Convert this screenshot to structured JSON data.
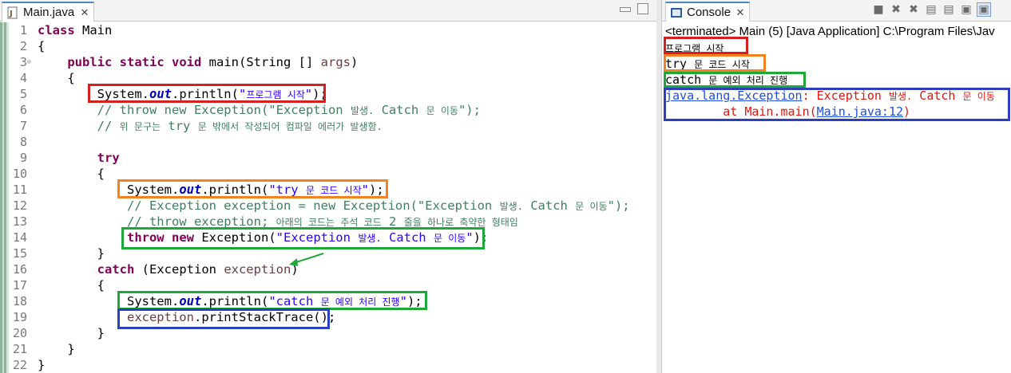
{
  "editor": {
    "tab_label": "Main.java",
    "tab_close": "✕",
    "lines": [
      {
        "num": "1",
        "parts": [
          {
            "c": "kw",
            "t": "class"
          },
          {
            "c": "",
            "t": " Main"
          }
        ]
      },
      {
        "num": "2",
        "parts": [
          {
            "c": "",
            "t": "{"
          }
        ]
      },
      {
        "num": "3",
        "fold": "⊖",
        "parts": [
          {
            "c": "",
            "t": "    "
          },
          {
            "c": "kw",
            "t": "public"
          },
          {
            "c": "",
            "t": " "
          },
          {
            "c": "kw",
            "t": "static"
          },
          {
            "c": "",
            "t": " "
          },
          {
            "c": "kw",
            "t": "void"
          },
          {
            "c": "",
            "t": " main(String [] "
          },
          {
            "c": "var",
            "t": "args"
          },
          {
            "c": "",
            "t": ")"
          }
        ]
      },
      {
        "num": "4",
        "parts": [
          {
            "c": "",
            "t": "    {"
          }
        ]
      },
      {
        "num": "5",
        "parts": [
          {
            "c": "",
            "t": "        System."
          },
          {
            "c": "sf",
            "t": "out"
          },
          {
            "c": "",
            "t": ".println("
          },
          {
            "c": "str",
            "t": "\""
          },
          {
            "c": "str str-k",
            "t": "프로그램 시작"
          },
          {
            "c": "str",
            "t": "\""
          },
          {
            "c": "",
            "t": ");"
          }
        ]
      },
      {
        "num": "6",
        "parts": [
          {
            "c": "",
            "t": "        "
          },
          {
            "c": "cm",
            "t": "// throw new Exception(\"Exception "
          },
          {
            "c": "cm cm-k",
            "t": "발생."
          },
          {
            "c": "cm",
            "t": " Catch "
          },
          {
            "c": "cm cm-k",
            "t": "문 이동"
          },
          {
            "c": "cm",
            "t": "\");"
          }
        ]
      },
      {
        "num": "7",
        "parts": [
          {
            "c": "",
            "t": "        "
          },
          {
            "c": "cm",
            "t": "// "
          },
          {
            "c": "cm cm-k",
            "t": "위 문구는"
          },
          {
            "c": "cm",
            "t": " try "
          },
          {
            "c": "cm cm-k",
            "t": "문 밖에서 작성되어 컴파일 에러가 발생함."
          }
        ]
      },
      {
        "num": "8",
        "parts": [
          {
            "c": "",
            "t": ""
          }
        ]
      },
      {
        "num": "9",
        "parts": [
          {
            "c": "",
            "t": "        "
          },
          {
            "c": "kw",
            "t": "try"
          }
        ]
      },
      {
        "num": "10",
        "parts": [
          {
            "c": "",
            "t": "        {"
          }
        ]
      },
      {
        "num": "11",
        "parts": [
          {
            "c": "",
            "t": "            System."
          },
          {
            "c": "sf",
            "t": "out"
          },
          {
            "c": "",
            "t": ".println("
          },
          {
            "c": "str",
            "t": "\"try "
          },
          {
            "c": "str str-k",
            "t": "문 코드 시작"
          },
          {
            "c": "str",
            "t": "\""
          },
          {
            "c": "",
            "t": ");"
          }
        ]
      },
      {
        "num": "12",
        "parts": [
          {
            "c": "",
            "t": "            "
          },
          {
            "c": "cm",
            "t": "// Exception exception = new Exception(\"Exception "
          },
          {
            "c": "cm cm-k",
            "t": "발생."
          },
          {
            "c": "cm",
            "t": " Catch "
          },
          {
            "c": "cm cm-k",
            "t": "문 이동"
          },
          {
            "c": "cm",
            "t": "\");"
          }
        ]
      },
      {
        "num": "13",
        "parts": [
          {
            "c": "",
            "t": "            "
          },
          {
            "c": "cm",
            "t": "// throw exception; "
          },
          {
            "c": "cm cm-k",
            "t": "아래의 코드는 주석 코드"
          },
          {
            "c": "cm",
            "t": " 2 "
          },
          {
            "c": "cm cm-k",
            "t": "줄을 하나로 축약한 형태임"
          }
        ]
      },
      {
        "num": "14",
        "parts": [
          {
            "c": "",
            "t": "            "
          },
          {
            "c": "kw",
            "t": "throw"
          },
          {
            "c": "",
            "t": " "
          },
          {
            "c": "kw",
            "t": "new"
          },
          {
            "c": "",
            "t": " Exception("
          },
          {
            "c": "str",
            "t": "\"Exception "
          },
          {
            "c": "str str-k",
            "t": "발생."
          },
          {
            "c": "str",
            "t": " Catch "
          },
          {
            "c": "str str-k",
            "t": "문 이동"
          },
          {
            "c": "str",
            "t": "\""
          },
          {
            "c": "",
            "t": ");"
          }
        ]
      },
      {
        "num": "15",
        "parts": [
          {
            "c": "",
            "t": "        }"
          }
        ]
      },
      {
        "num": "16",
        "parts": [
          {
            "c": "",
            "t": "        "
          },
          {
            "c": "kw",
            "t": "catch"
          },
          {
            "c": "",
            "t": " (Exception "
          },
          {
            "c": "var",
            "t": "exception"
          },
          {
            "c": "",
            "t": ")"
          }
        ]
      },
      {
        "num": "17",
        "parts": [
          {
            "c": "",
            "t": "        {"
          }
        ]
      },
      {
        "num": "18",
        "parts": [
          {
            "c": "",
            "t": "            System."
          },
          {
            "c": "sf",
            "t": "out"
          },
          {
            "c": "",
            "t": ".println("
          },
          {
            "c": "str",
            "t": "\"catch "
          },
          {
            "c": "str str-k",
            "t": "문 예외 처리 진행"
          },
          {
            "c": "str",
            "t": "\""
          },
          {
            "c": "",
            "t": ");"
          }
        ]
      },
      {
        "num": "19",
        "parts": [
          {
            "c": "",
            "t": "            "
          },
          {
            "c": "var",
            "t": "exception"
          },
          {
            "c": "",
            "t": ".printStackTrace();"
          }
        ]
      },
      {
        "num": "20",
        "parts": [
          {
            "c": "",
            "t": "        }"
          }
        ]
      },
      {
        "num": "21",
        "parts": [
          {
            "c": "",
            "t": "    }"
          }
        ]
      },
      {
        "num": "22",
        "parts": [
          {
            "c": "",
            "t": "}"
          }
        ]
      }
    ]
  },
  "console": {
    "tab_label": "Console",
    "tab_close": "✕",
    "tools": [
      "■",
      "✖",
      "✖",
      "▤",
      "▤",
      "▣",
      "▣"
    ],
    "header": "<terminated> Main (5) [Java Application] C:\\Program Files\\Jav",
    "lines": [
      {
        "parts": [
          {
            "c": "cl-k",
            "t": "프로그램 시작"
          }
        ]
      },
      {
        "parts": [
          {
            "c": "",
            "t": "try "
          },
          {
            "c": "cl-k",
            "t": "문 코드 시작"
          }
        ]
      },
      {
        "parts": [
          {
            "c": "",
            "t": "catch "
          },
          {
            "c": "cl-k",
            "t": "문 예외 처리 진행"
          }
        ]
      },
      {
        "parts": [
          {
            "c": "link",
            "t": "java.lang.Exception"
          },
          {
            "c": "err",
            "t": ": Exception "
          },
          {
            "c": "err cl-k",
            "t": "발생."
          },
          {
            "c": "err",
            "t": " Catch "
          },
          {
            "c": "err cl-k",
            "t": "문 이동"
          }
        ]
      },
      {
        "parts": [
          {
            "c": "err",
            "t": "        at Main.main("
          },
          {
            "c": "link",
            "t": "Main.java:12"
          },
          {
            "c": "err",
            "t": ")"
          }
        ]
      }
    ]
  },
  "colors": {
    "highlight_red": "#d62020",
    "highlight_orange": "#f58220",
    "highlight_green": "#1ea83a",
    "highlight_blue": "#2b3fbf"
  }
}
